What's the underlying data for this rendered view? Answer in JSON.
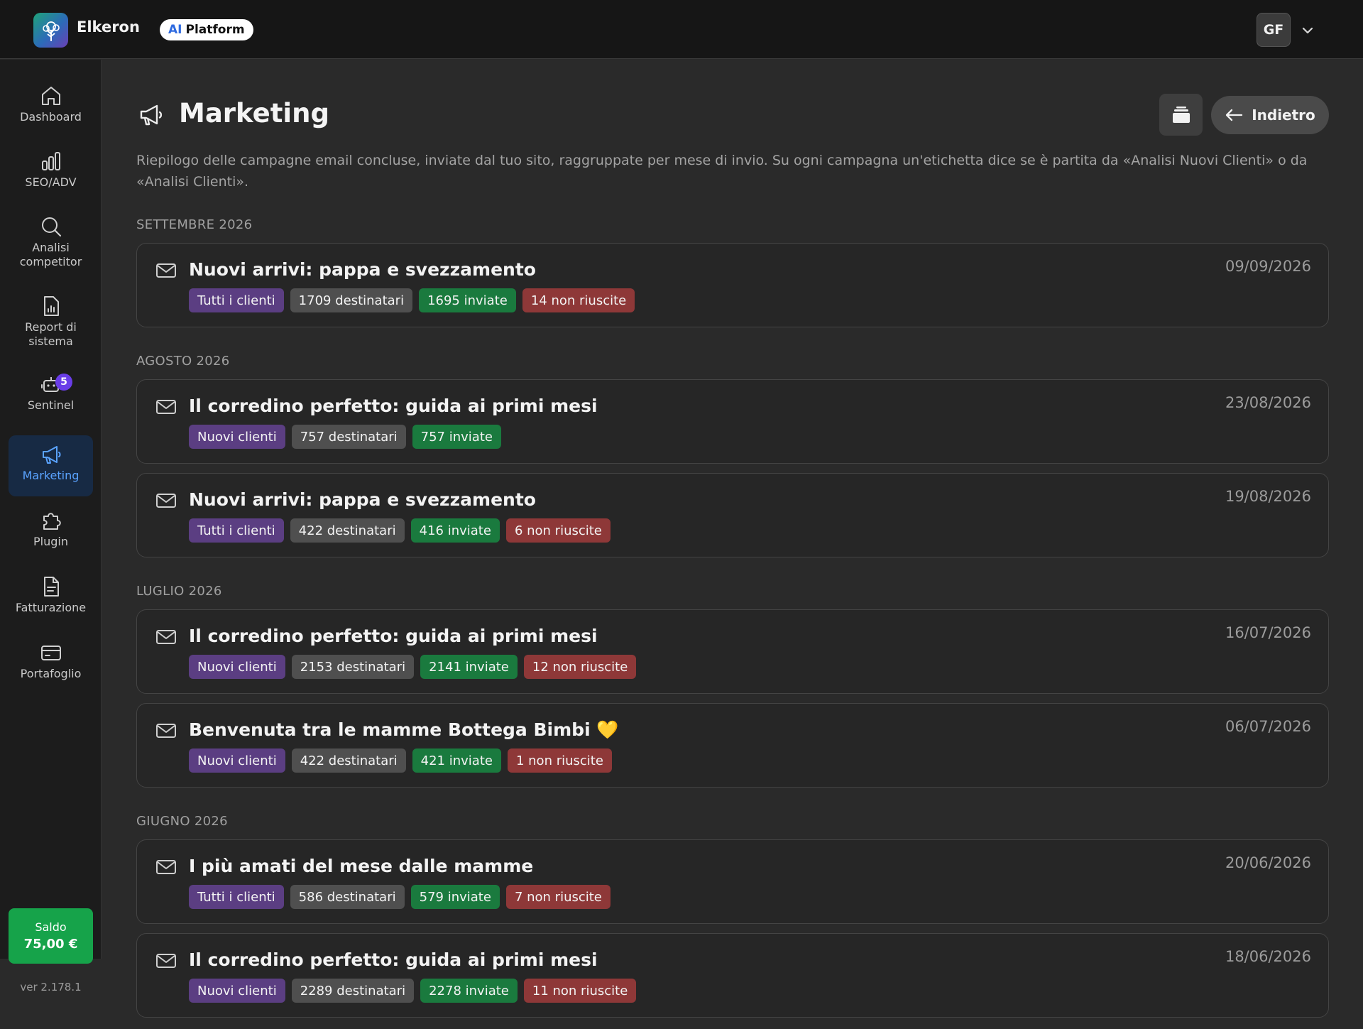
{
  "header": {
    "brand": "Elkeron",
    "ai_prefix": "AI",
    "platform": "Platform",
    "user_initials": "GF",
    "logo_icon": "tree-icon",
    "menu_icon": "chevron-down-icon"
  },
  "sidebar": {
    "items": [
      {
        "label": "Dashboard",
        "icon": "home-icon"
      },
      {
        "label": "SEO/ADV",
        "icon": "bar-chart-icon"
      },
      {
        "label": "Analisi competitor",
        "icon": "search-icon"
      },
      {
        "label": "Report di sistema",
        "icon": "report-icon"
      },
      {
        "label": "Sentinel",
        "icon": "robot-icon",
        "badge": "5"
      },
      {
        "label": "Marketing",
        "icon": "megaphone-icon",
        "active": true
      },
      {
        "label": "Plugin",
        "icon": "puzzle-icon"
      },
      {
        "label": "Fatturazione",
        "icon": "invoice-icon"
      },
      {
        "label": "Portafoglio",
        "icon": "wallet-icon"
      }
    ],
    "saldo_label": "Saldo",
    "saldo_value": "75,00 €",
    "version": "ver 2.178.1"
  },
  "main": {
    "title": "Marketing",
    "back_label": "Indietro",
    "description": "Riepilogo delle campagne email concluse, inviate dal tuo sito, raggruppate per mese di invio. Su ogni campagna un'etichetta dice se è partita da «Analisi Nuovi Clienti» o da «Analisi Clienti».",
    "groups": [
      {
        "month": "SETTEMBRE 2026",
        "campaigns": [
          {
            "title": "Nuovi arrivi: pappa e svezzamento",
            "date": "09/09/2026",
            "segment": "Tutti i clienti",
            "recipients": "1709 destinatari",
            "sent": "1695 inviate",
            "failed": "14 non riuscite"
          }
        ]
      },
      {
        "month": "AGOSTO 2026",
        "campaigns": [
          {
            "title": "Il corredino perfetto: guida ai primi mesi",
            "date": "23/08/2026",
            "segment": "Nuovi clienti",
            "recipients": "757 destinatari",
            "sent": "757 inviate",
            "failed": ""
          },
          {
            "title": "Nuovi arrivi: pappa e svezzamento",
            "date": "19/08/2026",
            "segment": "Tutti i clienti",
            "recipients": "422 destinatari",
            "sent": "416 inviate",
            "failed": "6 non riuscite"
          }
        ]
      },
      {
        "month": "LUGLIO 2026",
        "campaigns": [
          {
            "title": "Il corredino perfetto: guida ai primi mesi",
            "date": "16/07/2026",
            "segment": "Nuovi clienti",
            "recipients": "2153 destinatari",
            "sent": "2141 inviate",
            "failed": "12 non riuscite"
          },
          {
            "title": "Benvenuta tra le mamme Bottega Bimbi 💛",
            "date": "06/07/2026",
            "segment": "Nuovi clienti",
            "recipients": "422 destinatari",
            "sent": "421 inviate",
            "failed": "1 non riuscite"
          }
        ]
      },
      {
        "month": "GIUGNO 2026",
        "campaigns": [
          {
            "title": "I più amati del mese dalle mamme",
            "date": "20/06/2026",
            "segment": "Tutti i clienti",
            "recipients": "586 destinatari",
            "sent": "579 inviate",
            "failed": "7 non riuscite"
          },
          {
            "title": "Il corredino perfetto: guida ai primi mesi",
            "date": "18/06/2026",
            "segment": "Nuovi clienti",
            "recipients": "2289 destinatari",
            "sent": "2278 inviate",
            "failed": "11 non riuscite"
          }
        ]
      }
    ]
  },
  "colors": {
    "accent": "#5aa3ff",
    "saldo": "#16a34a",
    "tag_segment": "#5b3e82",
    "tag_recipients": "#4f4f4f",
    "tag_sent": "#1a7a3e",
    "tag_failed": "#8e3838"
  }
}
